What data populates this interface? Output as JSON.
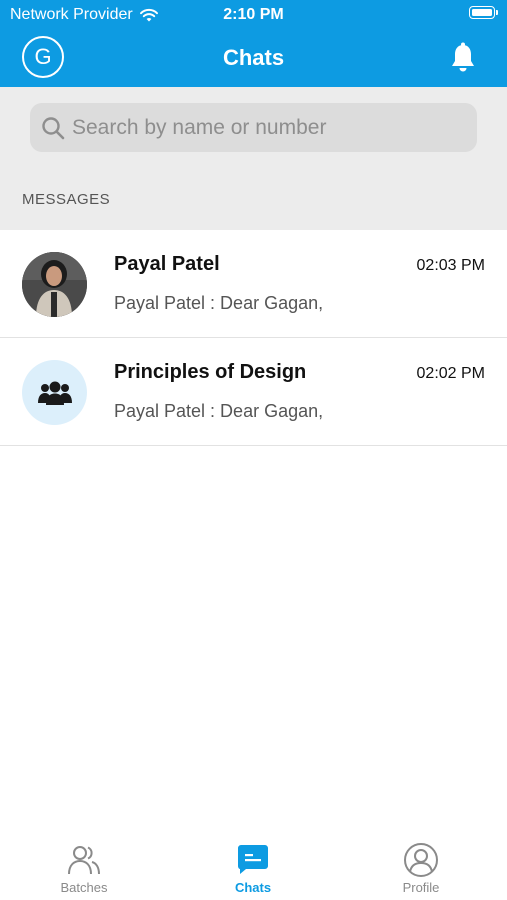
{
  "status_bar": {
    "carrier": "Network Provider",
    "time": "2:10 PM",
    "wifi_icon": "wifi-icon",
    "battery_icon": "battery-icon"
  },
  "header": {
    "avatar_initial": "G",
    "title": "Chats",
    "bell_icon": "bell-icon",
    "background_color": "#0d9be2"
  },
  "search": {
    "placeholder": "Search by name or number",
    "icon": "search-icon"
  },
  "section_label": "MESSAGES",
  "chats": [
    {
      "name": "Payal Patel",
      "time": "02:03 PM",
      "preview": "Payal Patel : Dear Gagan,",
      "avatar": "profile-photo"
    },
    {
      "name": "Principles of Design",
      "time": "02:02 PM",
      "preview": "Payal Patel : Dear Gagan,",
      "avatar": "group-icon"
    }
  ],
  "tabs": [
    {
      "label": "Batches",
      "icon": "batches-icon",
      "active": false
    },
    {
      "label": "Chats",
      "icon": "chats-icon",
      "active": true
    },
    {
      "label": "Profile",
      "icon": "profile-icon",
      "active": false
    }
  ],
  "colors": {
    "accent": "#0d9be2",
    "inactive_tab": "#8a8a8a",
    "search_bg": "#dcdcdc"
  }
}
